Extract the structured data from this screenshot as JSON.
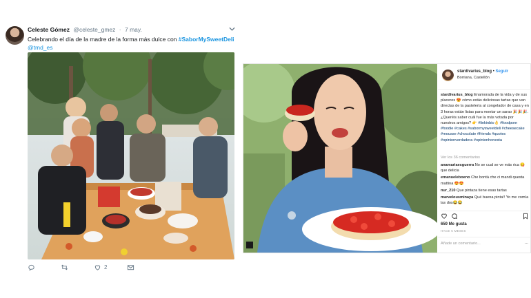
{
  "tweet": {
    "name": "Celeste Gómez",
    "handle": "@celeste_gmez",
    "separator": "·",
    "date": "7 may.",
    "text": "Celebrando el día de la madre de la forma más dulce con ",
    "hashtag": "#SaborMySweetDeli",
    "mention": "@tmd_es",
    "actions": {
      "reply_count": "",
      "retweet_count": "",
      "like_count": "2",
      "dm_count": ""
    },
    "icons": [
      "chevron-down-icon",
      "reply-icon",
      "retweet-icon",
      "heart-icon",
      "envelope-icon"
    ]
  },
  "instagram": {
    "username": "stardivarius_blog",
    "separator": "•",
    "follow_label": "Seguir",
    "location": "Borriana, Castellón",
    "caption_user": "stardivarius_blog",
    "caption_text": " Enamorada de la vida y de sus placeres 😍 cómo estás deliciosas tartas que van directas de la pastelería al congelador de casa y en 3 horas están listas para montar un sarao 🎉🎉🎉. ¿Queréis saber cuál fue la más votada por nuestros amigos? 👉",
    "caption_tags": " #linkinbio👌 #foodporn #foodie #cakes #sabormysweetdeli #cheesecake #mousse #chocolate #friends #quotes #opinionverdadera #opinionhonesta",
    "view_all": "Ver los 36 comentarios",
    "comments": [
      {
        "user": "anamariaesguerra",
        "text": " No se cual se ve más rica 😋 que delicia"
      },
      {
        "user": "emanueleboeno",
        "text": " Che bontà che ci mandi questa mattina 😍😍"
      },
      {
        "user": "nur_210",
        "text": " Que pintaza tiene esas tartas"
      },
      {
        "user": "marvelousminaya",
        "text": " Qué buena pinta!! Yo me comía las dos😂😂"
      }
    ],
    "likes": "659 Me gusta",
    "time": "HACE 5 MESES",
    "add_comment_placeholder": "Añade un comentario...",
    "more_label": "···",
    "icons": [
      "heart-icon",
      "comment-icon",
      "bookmark-icon"
    ]
  }
}
